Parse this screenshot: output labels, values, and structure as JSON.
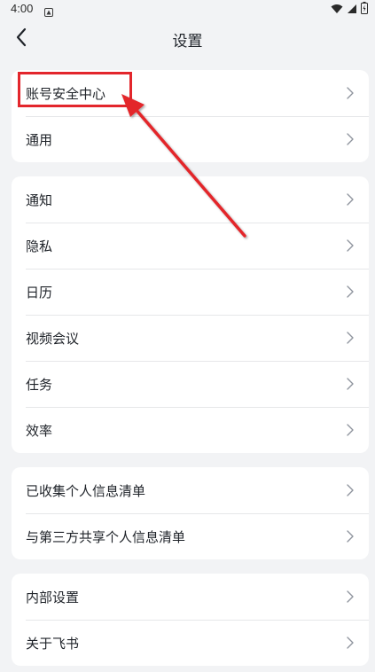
{
  "status_bar": {
    "time": "4:00"
  },
  "nav": {
    "title": "设置"
  },
  "groups": [
    {
      "items": [
        {
          "label": "账号安全中心"
        },
        {
          "label": "通用"
        }
      ]
    },
    {
      "items": [
        {
          "label": "通知"
        },
        {
          "label": "隐私"
        },
        {
          "label": "日历"
        },
        {
          "label": "视频会议"
        },
        {
          "label": "任务"
        },
        {
          "label": "效率"
        }
      ]
    },
    {
      "items": [
        {
          "label": "已收集个人信息清单"
        },
        {
          "label": "与第三方共享个人信息清单"
        }
      ]
    },
    {
      "items": [
        {
          "label": "内部设置"
        },
        {
          "label": "关于飞书"
        }
      ]
    }
  ],
  "annotation": {
    "color": "#e3262c",
    "target": "账号安全中心"
  }
}
